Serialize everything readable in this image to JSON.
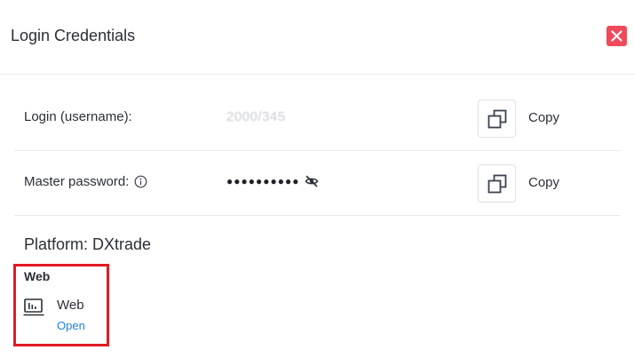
{
  "dialog": {
    "title": "Login Credentials",
    "close_icon": "close-icon",
    "close_color": "#f04a5a"
  },
  "credentials": [
    {
      "label": "Login (username):",
      "value": "2000/345",
      "copy_label": "Copy",
      "copy_icon": "copy-icon"
    },
    {
      "label": "Master password:",
      "info_icon": "info-icon",
      "value": "●●●●●●●●●●",
      "eye_icon": "eye-off-icon",
      "copy_label": "Copy",
      "copy_icon": "copy-icon"
    }
  ],
  "platform": {
    "title": "Platform: DXtrade",
    "section_heading": "Web",
    "item": {
      "icon": "web-terminal-icon",
      "name": "Web",
      "action": "Open",
      "action_color": "#1a82e6"
    },
    "highlight_color": "#e01b24"
  }
}
